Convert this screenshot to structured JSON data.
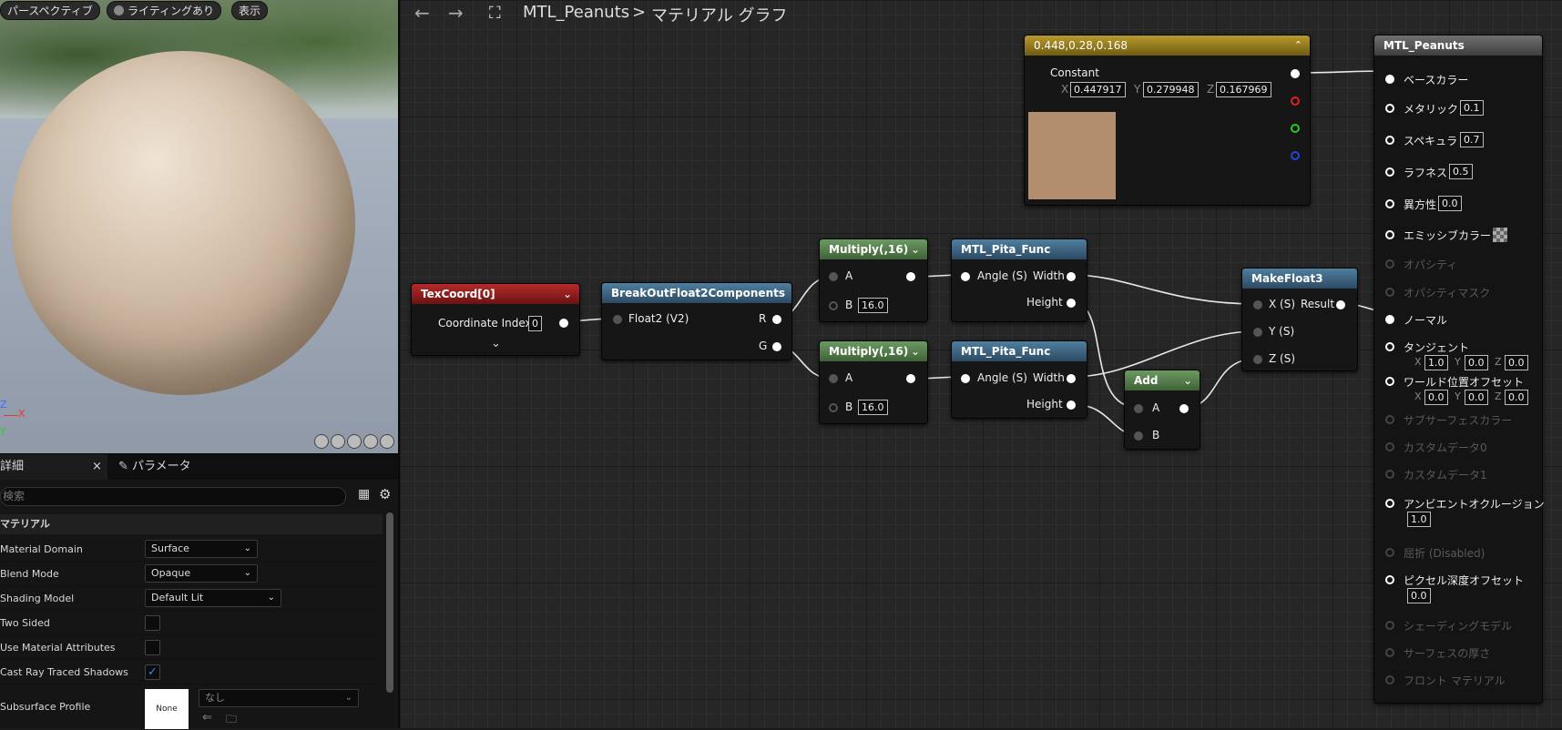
{
  "viewport": {
    "buttons": [
      "パースペクティブ",
      "ライティングあり",
      "表示"
    ],
    "axis_labels": {
      "z": "Z",
      "x": "X",
      "y": "Y"
    }
  },
  "details": {
    "tab_details": "詳細",
    "tab_params": "パラメータ",
    "search_placeholder": "検索",
    "section": "マテリアル",
    "rows": [
      {
        "label": "Material Domain",
        "value": "Surface"
      },
      {
        "label": "Blend Mode",
        "value": "Opaque"
      },
      {
        "label": "Shading Model",
        "value": "Default Lit"
      },
      {
        "label": "Two Sided",
        "checked": false
      },
      {
        "label": "Use Material Attributes",
        "checked": false
      },
      {
        "label": "Cast Ray Traced Shadows",
        "checked": true
      },
      {
        "label": "Subsurface Profile",
        "value": "なし",
        "thumb": "None"
      }
    ]
  },
  "toolbar": {
    "asset_name": "MTL_Peanuts",
    "separator": ">",
    "graph_name": "マテリアル グラフ"
  },
  "nodes": {
    "texcoord": {
      "title": "TexCoord[0]",
      "pin_label": "Coordinate Index",
      "value": "0"
    },
    "breakout": {
      "title": "BreakOutFloat2Components",
      "in_label": "Float2 (V2)",
      "out_r": "R",
      "out_g": "G"
    },
    "multiply1": {
      "title": "Multiply(,16)",
      "a": "A",
      "b": "B",
      "b_value": "16.0"
    },
    "multiply2": {
      "title": "Multiply(,16)",
      "a": "A",
      "b": "B",
      "b_value": "16.0"
    },
    "pita1": {
      "title": "MTL_Pita_Func",
      "in": "Angle (S)",
      "out_w": "Width",
      "out_h": "Height"
    },
    "pita2": {
      "title": "MTL_Pita_Func",
      "in": "Angle (S)",
      "out_w": "Width",
      "out_h": "Height"
    },
    "add": {
      "title": "Add",
      "a": "A",
      "b": "B"
    },
    "makefloat3": {
      "title": "MakeFloat3",
      "x": "X (S)",
      "y": "Y (S)",
      "z": "Z (S)",
      "result": "Result"
    },
    "constant": {
      "title": "0.448,0.28,0.168",
      "label": "Constant",
      "x_label": "X",
      "x": "0.447917",
      "y_label": "Y",
      "y": "0.279948",
      "z_label": "Z",
      "z": "0.167969",
      "swatch_color": "#b28e6f"
    }
  },
  "result_node": {
    "title": "MTL_Peanuts",
    "pins": [
      {
        "label": "ベースカラー",
        "active": true
      },
      {
        "label": "メタリック",
        "active": true,
        "value": "0.1"
      },
      {
        "label": "スペキュラ",
        "active": true,
        "value": "0.7"
      },
      {
        "label": "ラフネス",
        "active": true,
        "value": "0.5"
      },
      {
        "label": "異方性",
        "active": true,
        "value": "0.0"
      },
      {
        "label": "エミッシブカラー",
        "active": true,
        "swatch": true
      },
      {
        "label": "オパシティ",
        "active": false
      },
      {
        "label": "オパシティマスク",
        "active": false
      },
      {
        "label": "ノーマル",
        "active": true
      },
      {
        "label": "タンジェント",
        "active": true,
        "xyz": [
          "1.0",
          "0.0",
          "0.0"
        ]
      },
      {
        "label": "ワールド位置オフセット",
        "active": true,
        "xyz": [
          "0.0",
          "0.0",
          "0.0"
        ]
      },
      {
        "label": "サブサーフェスカラー",
        "active": false
      },
      {
        "label": "カスタムデータ0",
        "active": false
      },
      {
        "label": "カスタムデータ1",
        "active": false
      },
      {
        "label": "アンビエントオクルージョン",
        "active": true,
        "value": "1.0"
      },
      {
        "label": "屈折 (Disabled)",
        "active": false
      },
      {
        "label": "ピクセル深度オフセット",
        "active": true,
        "value": "0.0"
      },
      {
        "label": "シェーディングモデル",
        "active": false
      },
      {
        "label": "サーフェスの厚さ",
        "active": false
      },
      {
        "label": "フロント マテリアル",
        "active": false
      }
    ]
  },
  "colors": {
    "texcoord_header": "#8a1a1a",
    "function_header": "#3a6a8a",
    "math_header": "#4e7a46",
    "constant_header": "#8f7a1c",
    "result_header": "#555555",
    "accent": "#2f8bf2"
  }
}
